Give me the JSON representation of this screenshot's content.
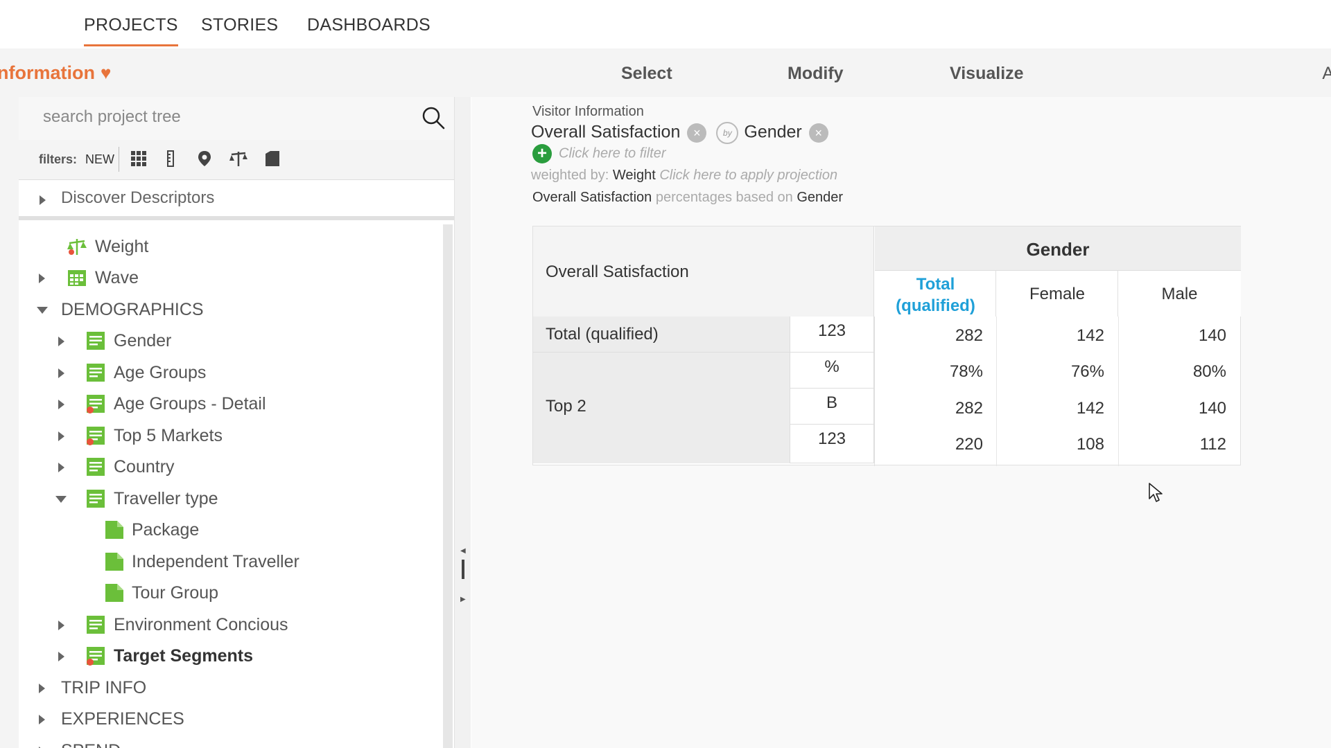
{
  "topnav": {
    "tabs": [
      "PROJECTS",
      "STORIES",
      "DASHBOARDS"
    ]
  },
  "subbar": {
    "project_title": "nformation",
    "steps": [
      "Select",
      "Modify",
      "Visualize"
    ],
    "overflow_letter": "A"
  },
  "sidebar": {
    "search_placeholder": "search project tree",
    "filters_label": "filters:",
    "filters_new": "NEW",
    "discover": "Discover Descriptors",
    "items": [
      {
        "label": "Weight"
      },
      {
        "label": "Wave"
      },
      {
        "label": "DEMOGRAPHICS"
      },
      {
        "label": "Gender"
      },
      {
        "label": "Age Groups"
      },
      {
        "label": "Age Groups - Detail"
      },
      {
        "label": "Top 5 Markets"
      },
      {
        "label": "Country"
      },
      {
        "label": "Traveller type"
      },
      {
        "label": "Package"
      },
      {
        "label": "Independent Traveller"
      },
      {
        "label": "Tour Group"
      },
      {
        "label": "Environment Concious"
      },
      {
        "label": "Target Segments"
      },
      {
        "label": "TRIP INFO"
      },
      {
        "label": "EXPERIENCES"
      },
      {
        "label": "SPEND"
      }
    ]
  },
  "main": {
    "breadcrumb": "Visitor Information",
    "row_var": "Overall Satisfaction",
    "by_label": "by",
    "col_var": "Gender",
    "filter_hint": "Click here to filter",
    "weighted_by_label": "weighted by:",
    "weight_value": "Weight",
    "projection_hint": "Click here to apply projection",
    "percent_var": "Overall Satisfaction",
    "percent_text": "percentages based on",
    "percent_base": "Gender"
  },
  "table": {
    "row_header": "Overall Satisfaction",
    "col_group": "Gender",
    "columns": [
      "Total (qualified)",
      "Female",
      "Male"
    ],
    "rows": [
      {
        "label": "Total (qualified)",
        "stat": "123",
        "values": [
          "282",
          "142",
          "140"
        ]
      },
      {
        "label": "Top 2",
        "stat": "%",
        "values": [
          "78%",
          "76%",
          "80%"
        ]
      },
      {
        "label": "",
        "stat": "B",
        "values": [
          "282",
          "142",
          "140"
        ]
      },
      {
        "label": "",
        "stat": "123",
        "values": [
          "220",
          "108",
          "112"
        ]
      }
    ]
  },
  "colors": {
    "accent": "#e8743b",
    "link": "#1fa0d8",
    "tree_icon": "#6bbf3a",
    "badge": "#e8543b"
  }
}
